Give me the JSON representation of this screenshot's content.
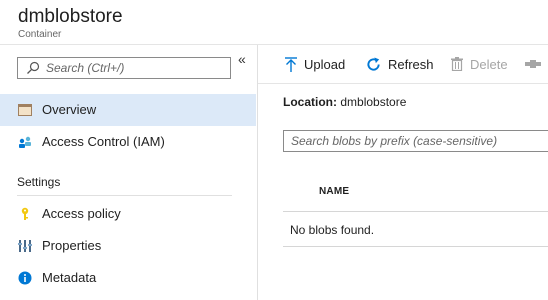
{
  "header": {
    "title": "dmblobstore",
    "subtitle": "Container"
  },
  "sidebar": {
    "search_placeholder": "Search (Ctrl+/)",
    "collapse_glyph": "«",
    "items": [
      {
        "label": "Overview",
        "icon": "overview-icon",
        "active": true
      },
      {
        "label": "Access Control (IAM)",
        "icon": "users-icon",
        "active": false
      }
    ],
    "section": "Settings",
    "settings_items": [
      {
        "label": "Access policy",
        "icon": "key-icon"
      },
      {
        "label": "Properties",
        "icon": "properties-icon"
      },
      {
        "label": "Metadata",
        "icon": "info-icon"
      }
    ]
  },
  "toolbar": {
    "upload": "Upload",
    "refresh": "Refresh",
    "delete": "Delete"
  },
  "main": {
    "location_key": "Location:",
    "location_value": "dmblobstore",
    "blob_search_placeholder": "Search blobs by prefix (case-sensitive)",
    "column_name": "NAME",
    "empty_message": "No blobs found."
  },
  "colors": {
    "accent": "#0078d4",
    "active_bg": "#dce9f8",
    "key_yellow": "#f2c811"
  }
}
